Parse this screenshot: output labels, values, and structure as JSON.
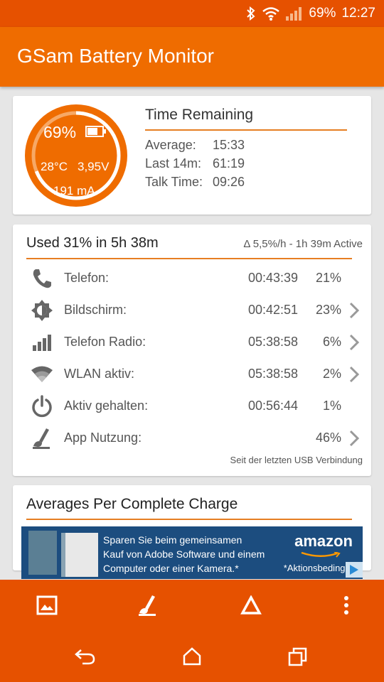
{
  "status_bar": {
    "battery": "69%",
    "time": "12:27",
    "icons": [
      "bluetooth-icon",
      "wifi-icon",
      "signal-icon"
    ]
  },
  "app_bar": {
    "title": "GSam Battery Monitor"
  },
  "gauge": {
    "percent": "69%",
    "level": 0.69,
    "temperature": "28°C",
    "voltage": "3,95V",
    "current": "191 mA"
  },
  "time_remaining": {
    "title": "Time Remaining",
    "rows": [
      {
        "label": "Average:",
        "value": "15:33"
      },
      {
        "label": "Last 14m:",
        "value": "61:19"
      },
      {
        "label": "Talk Time:",
        "value": "09:26"
      }
    ]
  },
  "usage": {
    "title": "Used 31% in 5h 38m",
    "subtitle": "Δ 5,5%/h - 1h 39m Active",
    "rows": [
      {
        "icon": "phone-icon",
        "label": "Telefon:",
        "time": "00:43:39",
        "pct": "21%",
        "chevron": false
      },
      {
        "icon": "brightness-icon",
        "label": "Bildschirm:",
        "time": "00:42:51",
        "pct": "23%",
        "chevron": true
      },
      {
        "icon": "signal-bars-icon",
        "label": "Telefon Radio:",
        "time": "05:38:58",
        "pct": "6%",
        "chevron": true
      },
      {
        "icon": "wifi-icon",
        "label": "WLAN aktiv:",
        "time": "05:38:58",
        "pct": "2%",
        "chevron": true
      },
      {
        "icon": "power-icon",
        "label": "Aktiv gehalten:",
        "time": "00:56:44",
        "pct": "1%",
        "chevron": false
      },
      {
        "icon": "app-usage-icon",
        "label": "App Nutzung:",
        "time": "",
        "pct": "46%",
        "chevron": true
      }
    ],
    "footnote": "Seit der letzten USB Verbindung"
  },
  "averages": {
    "title": "Averages Per Complete Charge"
  },
  "ad": {
    "line1": "Sparen Sie beim gemeinsamen",
    "line2": "Kauf von Adobe Software und einem",
    "line3": "Computer oder einer Kamera.*",
    "brand": "amazon",
    "note": "*Aktionsbedingun"
  },
  "toolbar": {
    "icons": [
      "image-icon",
      "app-usage-icon",
      "delta-icon",
      "overflow-menu-icon"
    ]
  },
  "nav": {
    "icons": [
      "back-icon",
      "home-icon",
      "recents-icon"
    ]
  },
  "colors": {
    "primary": "#ef6c00",
    "dark": "#e65100",
    "accent_line": "#e67e22"
  }
}
